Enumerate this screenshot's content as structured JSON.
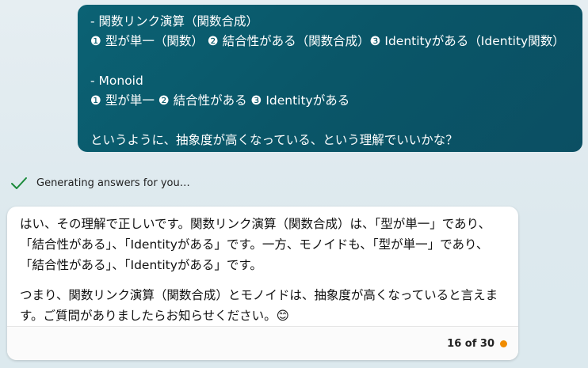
{
  "user_message": {
    "lines": [
      "- 関数リンク演算（関数合成）",
      "❶ 型が単一（関数） ❷ 結合性がある（関数合成）❸ Identityがある（Identity関数）",
      "",
      "- Monoid",
      "❶ 型が単一 ❷ 結合性がある ❸ Identityがある",
      "",
      "というように、抽象度が高くなっている、という理解でいいかな？"
    ]
  },
  "status": {
    "text": "Generating answers for you…",
    "icon": "check-icon",
    "color": "#1a8a3a"
  },
  "answer": {
    "paragraphs": [
      "はい、その理解で正しいです。関数リンク演算（関数合成）は、「型が単一」であり、「結合性がある」、「Identityがある」です。一方、モノイドも、「型が単一」であり、「結合性がある」、「Identityがある」です。",
      "つまり、関数リンク演算（関数合成）とモノイドは、抽象度が高くなっていると言えます。ご質問がありましたらお知らせください。😊"
    ],
    "counter": "16 of 30",
    "counter_dot_color": "#f08c00"
  }
}
